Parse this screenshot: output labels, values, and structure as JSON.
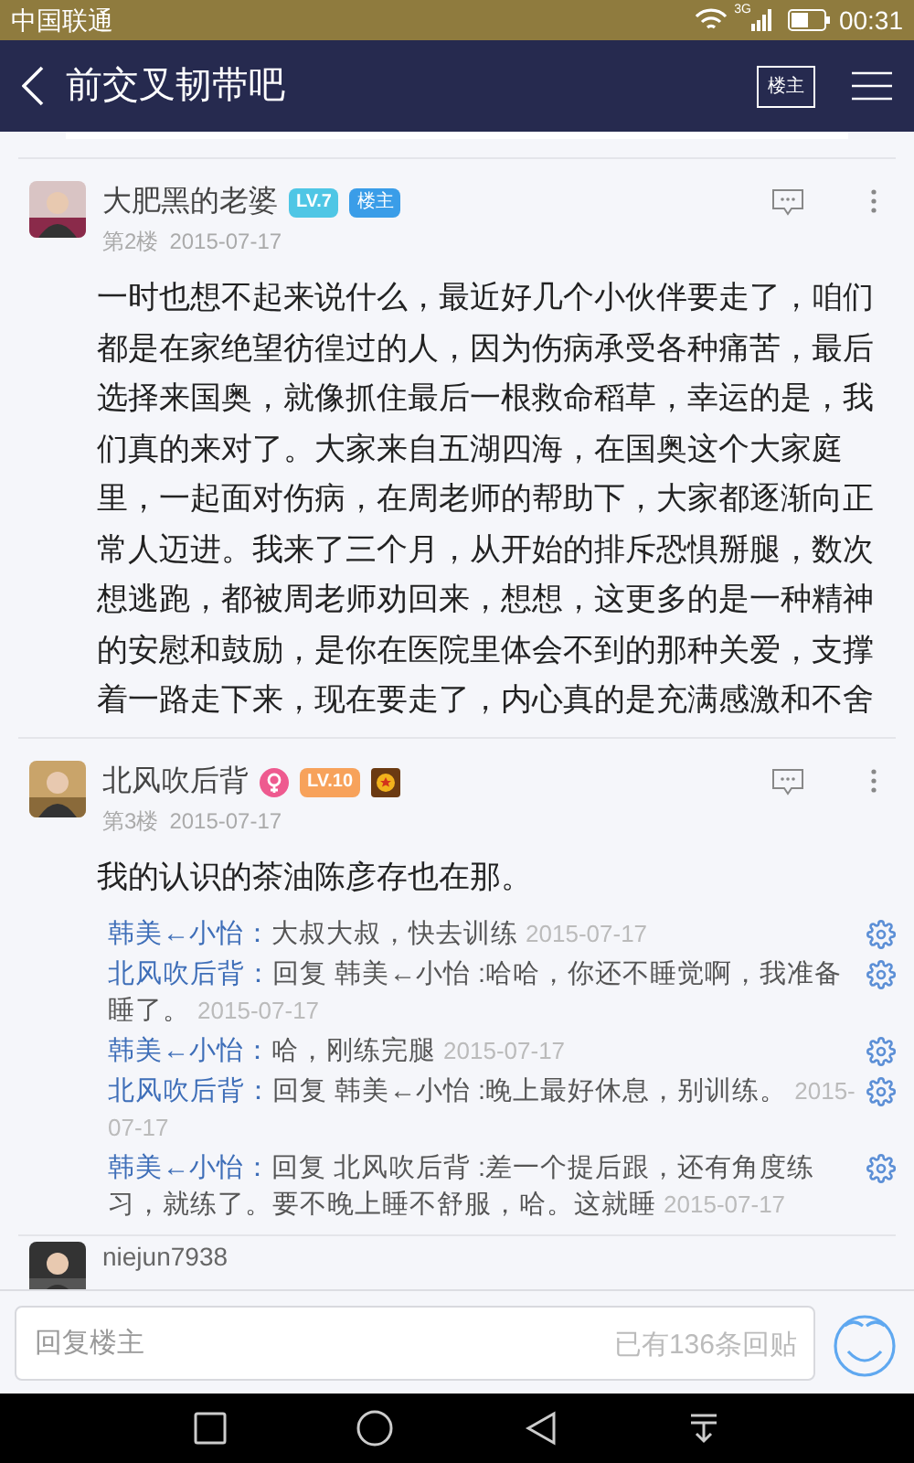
{
  "status_bar": {
    "carrier": "中国联通",
    "network": "3G",
    "time": "00:31"
  },
  "header": {
    "title": "前交叉韧带吧",
    "owner_button": "楼主"
  },
  "posts": [
    {
      "name": "大肥黑的老婆",
      "floor": "第2楼",
      "date": "2015-07-17",
      "badges": [
        {
          "kind": "level",
          "text": "LV.7",
          "color": "#4fc6e5"
        },
        {
          "kind": "owner",
          "text": "楼主"
        }
      ],
      "body": "一时也想不起来说什么，最近好几个小伙伴要走了，咱们都是在家绝望彷徨过的人，因为伤病承受各种痛苦，最后选择来国奥，就像抓住最后一根救命稻草，幸运的是，我们真的来对了。大家来自五湖四海，在国奥这个大家庭里，一起面对伤病，在周老师的帮助下，大家都逐渐向正常人迈进。我来了三个月，从开始的排斥恐惧掰腿，数次想逃跑，都被周老师劝回来，想想，这更多的是一种精神的安慰和鼓励，是你在医院里体会不到的那种关爱，支撑着一路走下来，现在要走了，内心真的是充满感激和不舍"
    },
    {
      "name": "北风吹后背",
      "floor": "第3楼",
      "date": "2015-07-17",
      "badges": [
        {
          "kind": "gender"
        },
        {
          "kind": "level",
          "text": "LV.10",
          "color": "#f7a25b"
        },
        {
          "kind": "medal"
        }
      ],
      "body": "我的认识的茶油陈彦存也在那。",
      "replies": [
        {
          "user": "韩美←小怡：",
          "text": "大叔大叔，快去训练",
          "date": "2015-07-17"
        },
        {
          "user": "北风吹后背：",
          "text": "回复 韩美←小怡 :哈哈，你还不睡觉啊，我准备睡了。",
          "date": "2015-07-17"
        },
        {
          "user": "韩美←小怡：",
          "text": "哈，刚练完腿",
          "date": "2015-07-17"
        },
        {
          "user": "北风吹后背：",
          "text": "回复 韩美←小怡 :晚上最好休息，别训练。",
          "date": "2015-07-17"
        },
        {
          "user": "韩美←小怡：",
          "text": "回复 北风吹后背 :差一个提后跟，还有角度练习，就练了。要不晚上睡不舒服，哈。这就睡",
          "date": "2015-07-17"
        }
      ]
    }
  ],
  "next_post": {
    "name": "niejun7938"
  },
  "composer": {
    "placeholder": "回复楼主",
    "count": "已有136条回贴"
  }
}
